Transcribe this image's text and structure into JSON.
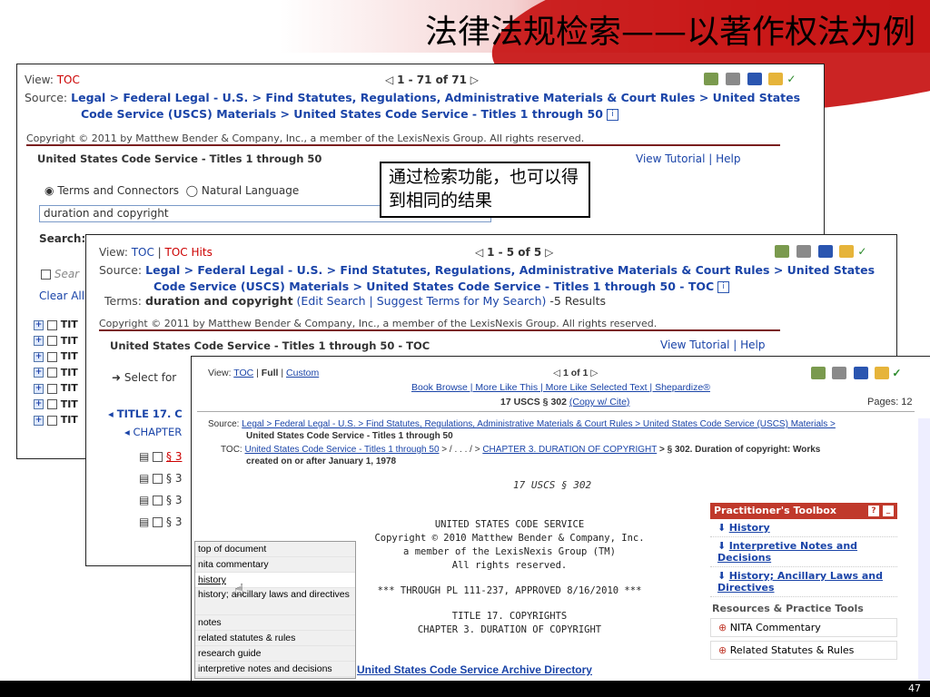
{
  "slide": {
    "title": "法律法规检索——以著作权法为例",
    "page_number": "47",
    "callout": "通过检索功能，也可以得到相同的结果"
  },
  "shot1": {
    "view_label": "View:",
    "view_value": "TOC",
    "pager": "1 - 71 of 71",
    "source_label": "Source:",
    "source_path_line1": "Legal > Federal Legal - U.S. > Find Statutes, Regulations, Administrative Materials & Court Rules > United States",
    "source_path_line2": "Code Service (USCS) Materials > United States Code Service - Titles 1 through 50",
    "copyright": "Copyright © 2011 by Matthew Bender & Company, Inc., a member of the LexisNexis Group. All rights reserved.",
    "header_title": "United States Code Service - Titles 1 through 50",
    "tutorial_link": "View Tutorial",
    "help_link": "Help",
    "radio1": "Terms and Connectors",
    "radio2": "Natural Language",
    "search_value": "duration and copyright",
    "search_label": "Search:",
    "sear_text": "Sear",
    "clear_text": "Clear All",
    "toc_rows": [
      "TIT",
      "TIT",
      "TIT",
      "TIT",
      "TIT",
      "TIT",
      "TIT"
    ]
  },
  "shot2": {
    "view_label": "View:",
    "view_toc": "TOC",
    "view_hits": "TOC Hits",
    "pager": "1 - 5 of 5",
    "source_label": "Source:",
    "source_path_line1": "Legal > Federal Legal - U.S. > Find Statutes, Regulations, Administrative Materials & Court Rules > United States",
    "source_path_line2": "Code Service (USCS) Materials > United States Code Service - Titles 1 through 50 - TOC",
    "terms_label": "Terms:",
    "terms_value": "duration and copyright",
    "edit_search": "(Edit Search | Suggest Terms for My Search)",
    "results": "-5 Results",
    "copyright": "Copyright © 2011 by Matthew Bender & Company, Inc., a member of the LexisNexis Group. All rights reserved.",
    "header_title": "United States Code Service - Titles 1 through 50 - TOC",
    "tutorial_link": "View Tutorial",
    "help_link": "Help",
    "select_for": "Select for",
    "title17": "TITLE 17. C",
    "chapter": "CHAPTER",
    "sections": [
      "§ 3",
      "§ 3",
      "§ 3",
      "§ 3"
    ]
  },
  "shot3": {
    "view_label": "View:",
    "view_toc": "TOC",
    "view_full": "Full",
    "view_custom": "Custom",
    "pager": "1 of 1",
    "links_line": "Book Browse | More Like This | More Like Selected Text | Shepardize®",
    "cite": "17 USCS § 302",
    "copy_cite": "(Copy w/ Cite)",
    "pages": "Pages: 12",
    "source_label": "Source:",
    "source_path": "Legal > Federal Legal - U.S. > Find Statutes, Regulations, Administrative Materials & Court Rules > United States Code Service (USCS) Materials >",
    "source_path2": "United States Code Service - Titles 1 through 50",
    "toc_label": "TOC:",
    "toc_path1": "United States Code Service - Titles 1 through 50",
    "toc_path_mid": "> / . . . / > ",
    "toc_chapter": "CHAPTER 3. DURATION OF COPYRIGHT",
    "toc_path_end": "> § 302. Duration of copyright: Works",
    "toc_path2": "created on or after January 1, 1978",
    "doc_cite": "17 USCS § 302",
    "body_lines": [
      "UNITED STATES CODE SERVICE",
      "Copyright © 2010 Matthew Bender & Company, Inc.",
      "a member of the LexisNexis Group (TM)",
      "All rights reserved.",
      "*** THROUGH PL 111-237, APPROVED 8/16/2010 ***",
      "TITLE 17. COPYRIGHTS",
      "CHAPTER 3. DURATION OF COPYRIGHT"
    ],
    "archive_link": "United States Code Service Archive Directory",
    "toolbox_title": "Practitioner's Toolbox",
    "toolbox_items": [
      "History",
      "Interpretive Notes and Decisions",
      "History; Ancillary Laws and Directives"
    ],
    "resources_title": "Resources & Practice Tools",
    "resources_items": [
      "NITA Commentary",
      "Related Statutes & Rules"
    ]
  },
  "menu": {
    "items": [
      "top of document",
      "nita commentary",
      "history",
      "history; ancillary laws and directives",
      "notes",
      "related statutes & rules",
      "research guide",
      "interpretive notes and decisions"
    ]
  },
  "colors": {
    "accent_red": "#c81818",
    "link_blue": "#1a44a8",
    "divider": "#7a1e1e"
  }
}
